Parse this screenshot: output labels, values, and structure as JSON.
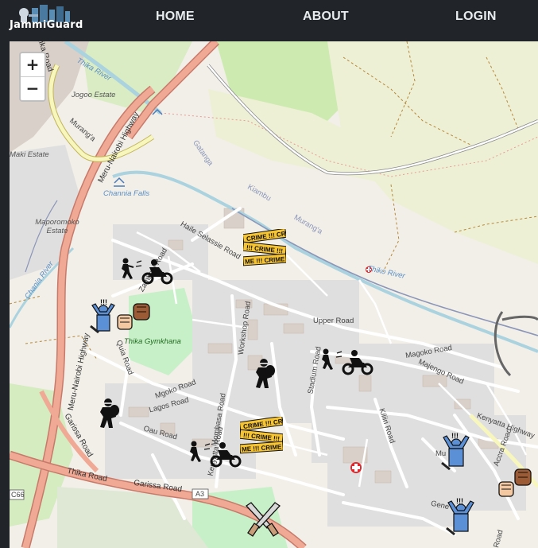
{
  "navbar": {
    "brand": "JammiGuard",
    "links": [
      "HOME",
      "ABOUT",
      "LOGIN"
    ]
  },
  "zoom": {
    "in_label": "+",
    "out_label": "−"
  },
  "map_labels": {
    "thika_road_top": "Thika Road",
    "thika_river_top": "Thika River",
    "jogoo_estate": "Jogoo Estate",
    "muranga_road_left": "Murang'a",
    "maki_estate": "Maki Estate",
    "meru_highway_top": "Meru-Nairobi Highway",
    "channia_falls": "Channia Falls",
    "gatanga": "Gatanga",
    "kiambu": "Kiambu",
    "muranga_a": "Murang'a",
    "maporomoko_estate": "Maporomoko Estate",
    "chania_river": "Chania River",
    "thiko_river": "Thiko River",
    "haile_selassie": "Haile Selassie Road",
    "zambezi_road": "Zambezi Road",
    "workshop_road": "Workshop Road",
    "upper_road": "Upper Road",
    "thika_gymkhana": "Thika Gymkhana",
    "quia_road": "Quia Road",
    "meru_highway_mid": "Meru-Nairobi Highway",
    "magoko_road": "Magoko Road",
    "majengo_road": "Majengo Road",
    "stadium_road": "Stadium Road",
    "mgoko_road": "Mgoko Road",
    "lagos_road": "Lagos Road",
    "oau_road": "Oau Road",
    "mombasa_road": "Mombasa Road",
    "kenyatta_road": "Kenyatta Road",
    "kiliiri_road": "Kiliiri Road",
    "kenyatta_highway": "Kenyatta Highway",
    "accra_road": "Accra Road",
    "garissa_road_left": "Garissa Road",
    "thika_road_bottom": "Thika Road",
    "garissa_road_bottom": "Garissa Road",
    "a3": "A3",
    "c66": "C66",
    "muranga_bottom": "Mu",
    "general": "Gene",
    "road_bottom": "Road"
  },
  "markers": [
    {
      "name": "robbery-marker-1",
      "icon": "thief-motorbike"
    },
    {
      "name": "crime-tape-marker-1",
      "icon": "crime-tape"
    },
    {
      "name": "assault-marker-1",
      "icon": "fist-fight"
    },
    {
      "name": "burglar-marker-1",
      "icon": "burglar"
    },
    {
      "name": "robbery-marker-2",
      "icon": "thief-motorbike"
    },
    {
      "name": "burglar-marker-2",
      "icon": "burglar"
    },
    {
      "name": "crime-tape-marker-2",
      "icon": "crime-tape"
    },
    {
      "name": "robbery-marker-3",
      "icon": "thief-motorbike"
    },
    {
      "name": "assault-marker-2",
      "icon": "fist-fight"
    },
    {
      "name": "assault-marker-3",
      "icon": "fist-fight"
    },
    {
      "name": "gun-marker-1",
      "icon": "crossed-guns"
    },
    {
      "name": "assault-marker-4",
      "icon": "fist-fight"
    }
  ],
  "crime_tape_text": "CRIME",
  "crime_tape_small": "!!!",
  "colors": {
    "navbar": "#212529",
    "map_land": "#f2efe9",
    "primary_road": "#f0a995",
    "secondary_road": "#f7f6bc",
    "river": "#aad3df",
    "park": "#c8f0c8",
    "hospital": "#e3262c"
  }
}
